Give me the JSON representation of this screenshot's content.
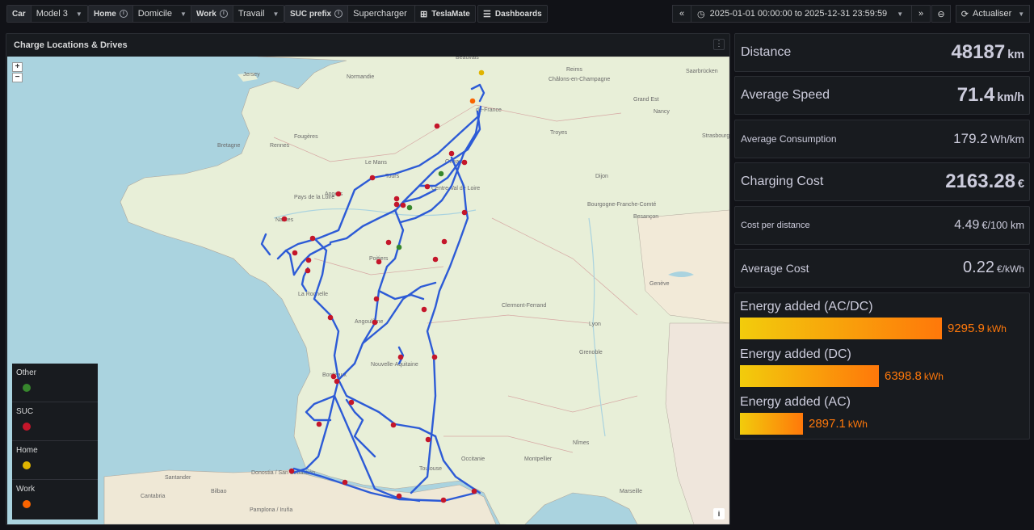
{
  "topbar": {
    "car": {
      "label": "Car",
      "value": "Model 3"
    },
    "home": {
      "label": "Home",
      "value": "Domicile"
    },
    "work": {
      "label": "Work",
      "value": "Travail"
    },
    "suc": {
      "label": "SUC prefix",
      "value": "Supercharger"
    },
    "teslamate_btn": "TeslaMate",
    "dashboards_btn": "Dashboards",
    "time_range": "2025-01-01 00:00:00 to 2025-12-31 23:59:59",
    "refresh_btn": "Actualiser"
  },
  "map_panel": {
    "title": "Charge Locations & Drives",
    "zoom_in": "+",
    "zoom_out": "−",
    "attribution": "i",
    "legend": [
      {
        "label": "Other",
        "color": "#37872d"
      },
      {
        "label": "SUC",
        "color": "#c4162a"
      },
      {
        "label": "Home",
        "color": "#e0b400"
      },
      {
        "label": "Work",
        "color": "#fa6400"
      }
    ],
    "places": [
      "Jersey",
      "Beauvais",
      "Normandie",
      "Reims",
      "Châlons-en-Champagne",
      "Saarbrücken",
      "de-France",
      "Grand Est",
      "Bretagne",
      "Rennes",
      "Fougères",
      "Le Mans",
      "Troyes",
      "Nancy",
      "Orléans",
      "Strasbourg",
      "Pays de la Loire",
      "Angers",
      "Tours",
      "Centre-Val de Loire",
      "Dijon",
      "Nantes",
      "Bourgogne-Franche-Comté",
      "Besançon",
      "Poitiers",
      "La Rochelle",
      "Clermont-Ferrand",
      "Lyon",
      "Genève",
      "Angoulême",
      "Nouvelle-Aquitaine",
      "Grenoble",
      "Bordeaux",
      "Occitanie",
      "Toulouse",
      "Montpellier",
      "Nîmes",
      "Marseille",
      "Donostia / San Sebastián",
      "Santander",
      "Bilbao",
      "Pamplona / Iruña",
      "Cantabria"
    ]
  },
  "stats": [
    {
      "name": "Distance",
      "value": "48187",
      "unit": "km"
    },
    {
      "name": "Average Speed",
      "value": "71.4",
      "unit": "km/h"
    },
    {
      "name": "Average Consumption",
      "value": "179.2",
      "unit": "Wh/km"
    },
    {
      "name": "Charging Cost",
      "value": "2163.28",
      "unit": "€"
    },
    {
      "name": "Cost per distance",
      "value": "4.49",
      "unit": "€/100 km"
    },
    {
      "name": "Average Cost",
      "value": "0.22",
      "unit": "€/kWh"
    }
  ],
  "energy": [
    {
      "name": "Energy added (AC/DC)",
      "value": "9295.9",
      "unit": "kWh",
      "fraction": 1.0
    },
    {
      "name": "Energy added (DC)",
      "value": "6398.8",
      "unit": "kWh",
      "fraction": 0.688
    },
    {
      "name": "Energy added (AC)",
      "value": "2897.1",
      "unit": "kWh",
      "fraction": 0.312
    }
  ]
}
